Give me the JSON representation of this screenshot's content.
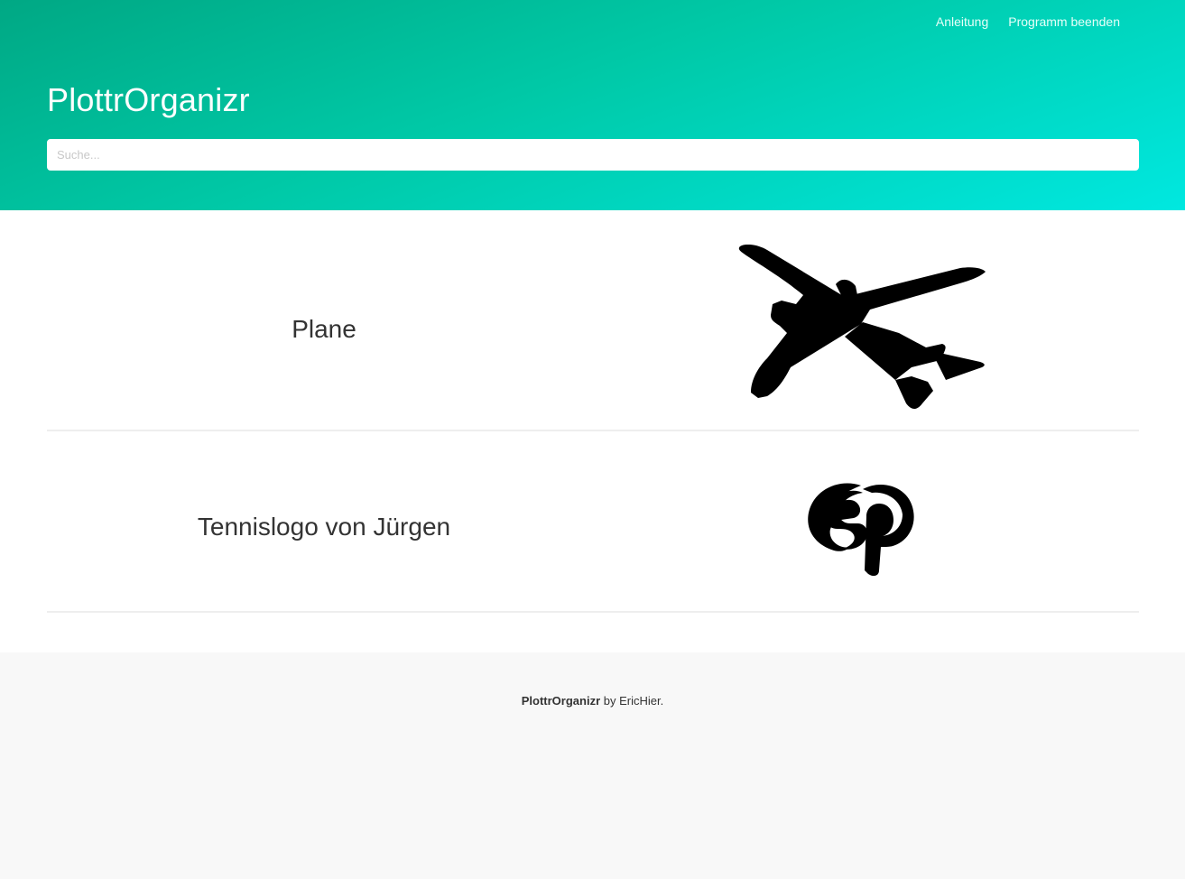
{
  "header": {
    "title": "PlottrOrganizr",
    "nav": {
      "guide_label": "Anleitung",
      "quit_label": "Programm beenden"
    },
    "search": {
      "placeholder": "Suche...",
      "value": ""
    }
  },
  "items": [
    {
      "title": "Plane",
      "image_icon": "airplane-silhouette"
    },
    {
      "title": "Tennislogo von Jürgen",
      "image_icon": "sp-tennis-logo"
    }
  ],
  "footer": {
    "app_name": "PlottrOrganizr",
    "by_text": " by ",
    "author": "EricHier",
    "suffix": "."
  },
  "colors": {
    "hero_gradient_start": "#00a884",
    "hero_gradient_end": "#00e8e0",
    "footer_bg": "#f8f8f8"
  }
}
